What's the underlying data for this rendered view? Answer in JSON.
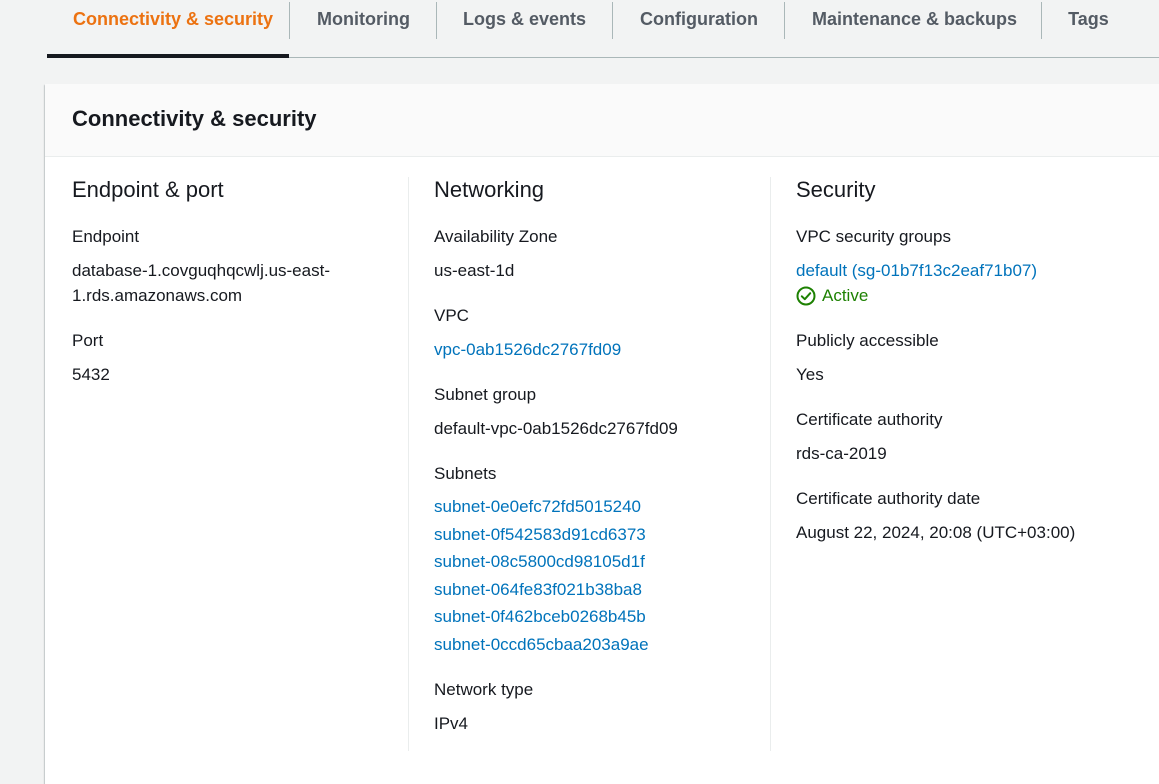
{
  "tabs": [
    {
      "label": "Connectivity & security",
      "active": true
    },
    {
      "label": "Monitoring"
    },
    {
      "label": "Logs & events"
    },
    {
      "label": "Configuration"
    },
    {
      "label": "Maintenance & backups"
    },
    {
      "label": "Tags"
    }
  ],
  "panel": {
    "title": "Connectivity & security"
  },
  "endpoint_port": {
    "title": "Endpoint & port",
    "endpoint_label": "Endpoint",
    "endpoint_line1": "database-1.covguqhqcwlj.us-east-",
    "endpoint_line2": "1.rds.amazonaws.com",
    "port_label": "Port",
    "port_value": "5432"
  },
  "networking": {
    "title": "Networking",
    "az_label": "Availability Zone",
    "az_value": "us-east-1d",
    "vpc_label": "VPC",
    "vpc_value": "vpc-0ab1526dc2767fd09",
    "subnet_group_label": "Subnet group",
    "subnet_group_value": "default-vpc-0ab1526dc2767fd09",
    "subnets_label": "Subnets",
    "subnets": [
      "subnet-0e0efc72fd5015240",
      "subnet-0f542583d91cd6373",
      "subnet-08c5800cd98105d1f",
      "subnet-064fe83f021b38ba8",
      "subnet-0f462bceb0268b45b",
      "subnet-0ccd65cbaa203a9ae"
    ],
    "network_type_label": "Network type",
    "network_type_value": "IPv4"
  },
  "security": {
    "title": "Security",
    "sg_label": "VPC security groups",
    "sg_value": "default (sg-01b7f13c2eaf71b07)",
    "sg_status": "Active",
    "sg_status_icon": "check-circle-icon",
    "public_label": "Publicly accessible",
    "public_value": "Yes",
    "ca_label": "Certificate authority",
    "ca_value": "rds-ca-2019",
    "ca_date_label": "Certificate authority date",
    "ca_date_value": "August 22, 2024, 20:08 (UTC+03:00)"
  },
  "colors": {
    "active_tab": "#ec7211",
    "link": "#0073bb",
    "success": "#1d8102"
  }
}
